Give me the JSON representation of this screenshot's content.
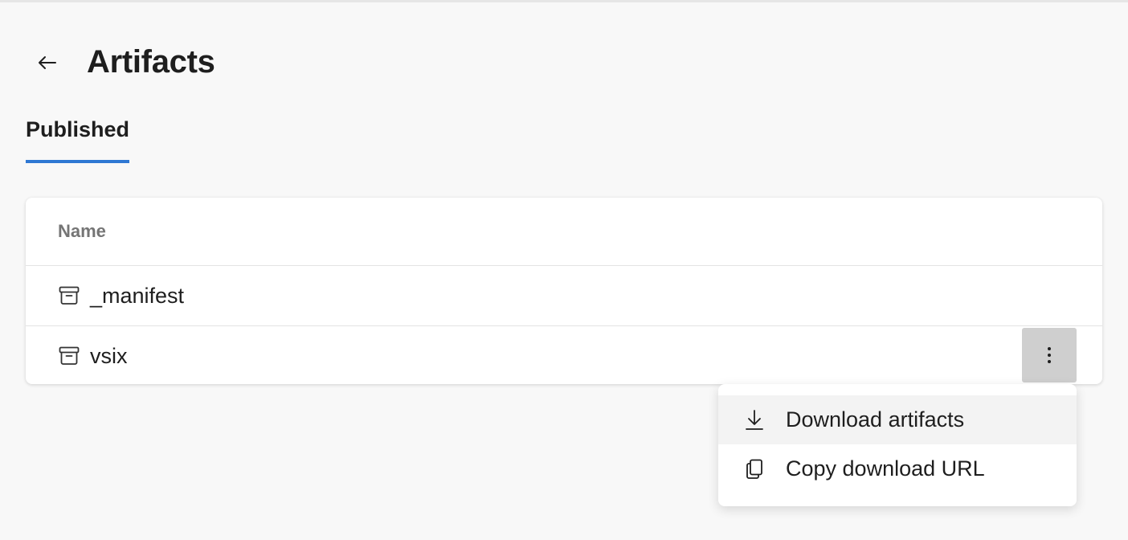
{
  "header": {
    "back_icon": "arrow-left-icon",
    "title": "Artifacts"
  },
  "tabs": [
    {
      "label": "Published",
      "selected": true
    }
  ],
  "accent_color": "#2f78d3",
  "table": {
    "column_header": "Name",
    "rows": [
      {
        "icon": "archive-box-icon",
        "name": "_manifest"
      },
      {
        "icon": "archive-box-icon",
        "name": "vsix",
        "has_more_button": true
      }
    ],
    "more_icon": "vertical-ellipsis-icon"
  },
  "context_menu": {
    "items": [
      {
        "icon": "download-icon",
        "label": "Download artifacts",
        "highlighted": true
      },
      {
        "icon": "copy-icon",
        "label": "Copy download URL"
      }
    ]
  }
}
